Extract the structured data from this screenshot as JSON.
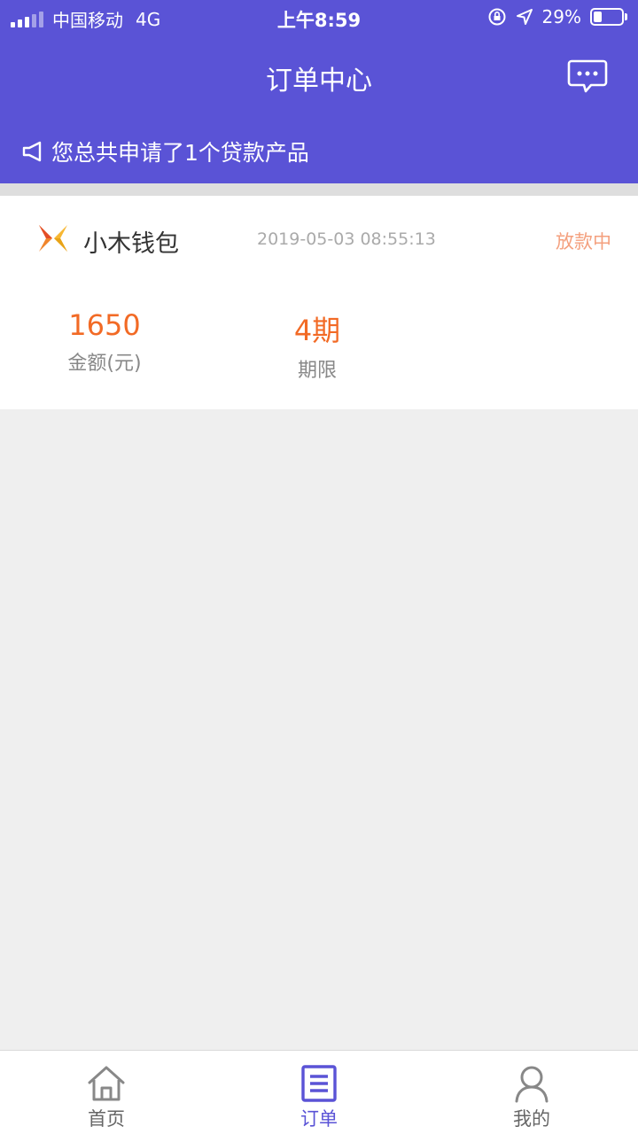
{
  "status_bar": {
    "carrier": "中国移动",
    "network": "4G",
    "time": "上午8:59",
    "battery": "29%",
    "battery_level": 0.29
  },
  "header": {
    "title": "订单中心",
    "notice": "您总共申请了1个贷款产品",
    "message_icon": "chat-bubble-icon"
  },
  "order": {
    "product_name": "小木钱包",
    "time": "2019-05-03 08:55:13",
    "status": "放款中",
    "amount": "1650",
    "amount_label": "金额(元)",
    "period": "4期",
    "period_label": "期限"
  },
  "tabbar": {
    "items": [
      {
        "label": "首页",
        "icon": "home-icon",
        "active": false
      },
      {
        "label": "订单",
        "icon": "order-list-icon",
        "active": true
      },
      {
        "label": "我的",
        "icon": "user-icon",
        "active": false
      }
    ]
  },
  "colors": {
    "primary": "#5a53d6",
    "accent": "#f26a25",
    "status": "#f4a07e",
    "background": "#efefef"
  }
}
